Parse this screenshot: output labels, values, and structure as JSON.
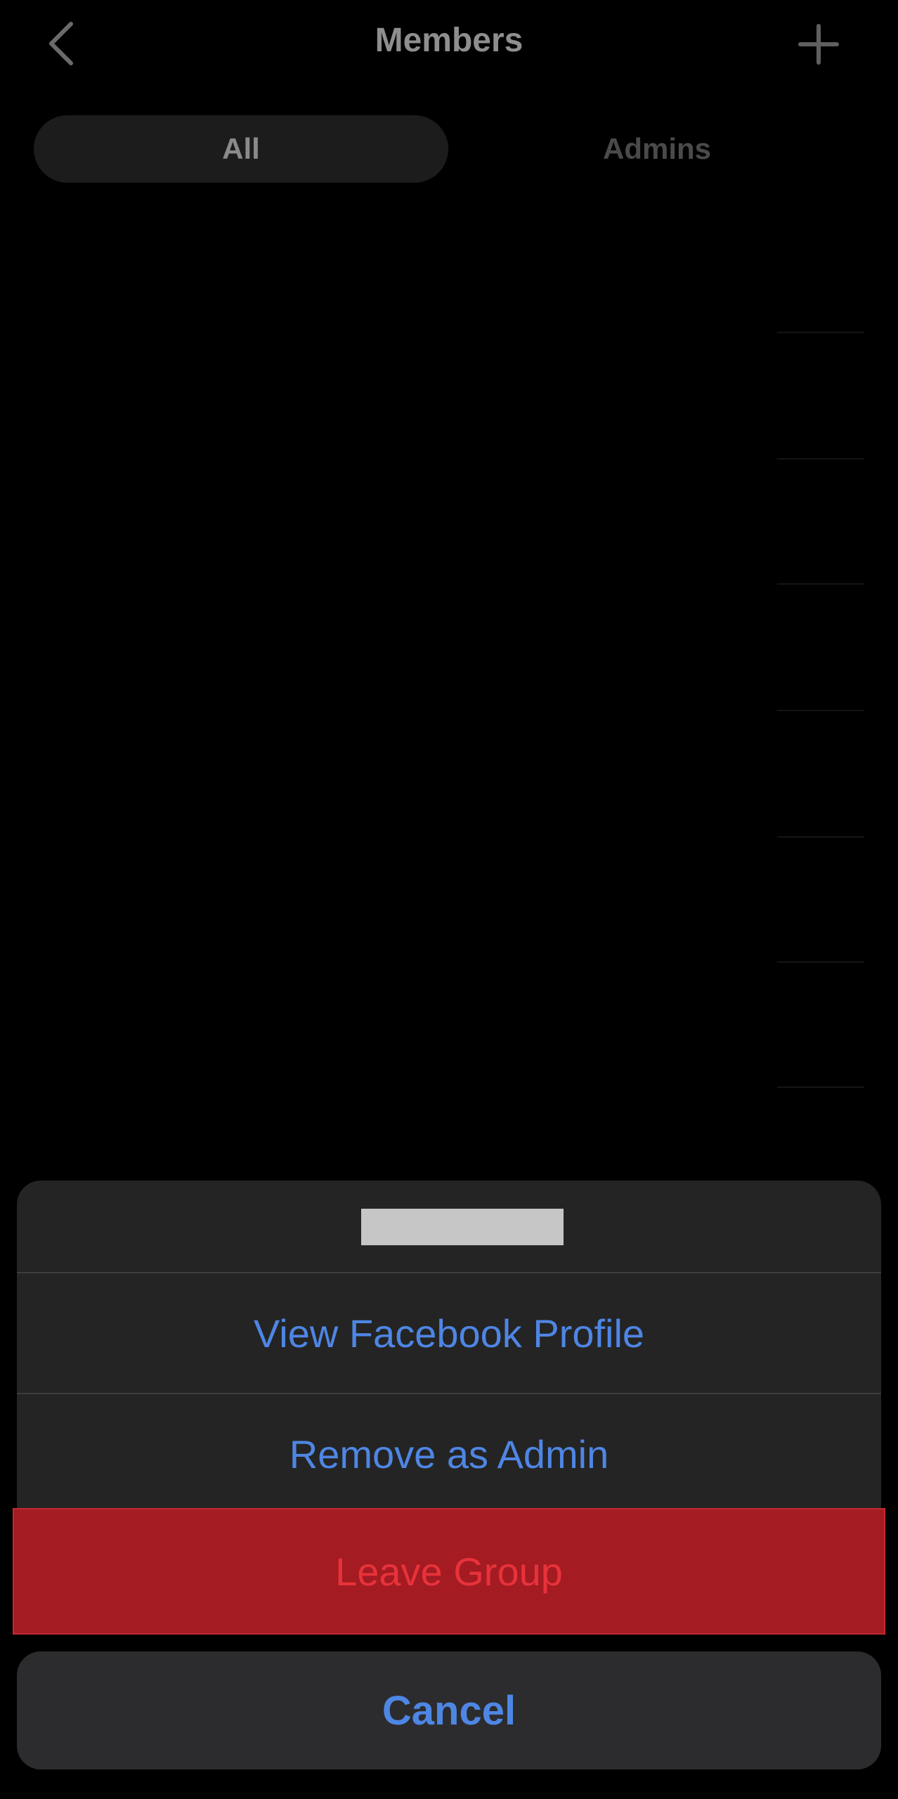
{
  "header": {
    "title": "Members",
    "back_icon": "chevron-left-icon",
    "add_icon": "plus-icon"
  },
  "tabs": [
    {
      "label": "All",
      "selected": true
    },
    {
      "label": "Admins",
      "selected": false
    }
  ],
  "action_sheet": {
    "name_redacted": true,
    "actions": [
      {
        "label": "View Facebook Profile"
      },
      {
        "label": "Remove as Admin"
      },
      {
        "label": "Leave Group"
      }
    ],
    "cancel_label": "Cancel"
  },
  "colors": {
    "background": "#000000",
    "action_blue": "#4e86e4",
    "destructive_red": "#e8323a",
    "highlight_red": "#a41b22"
  }
}
